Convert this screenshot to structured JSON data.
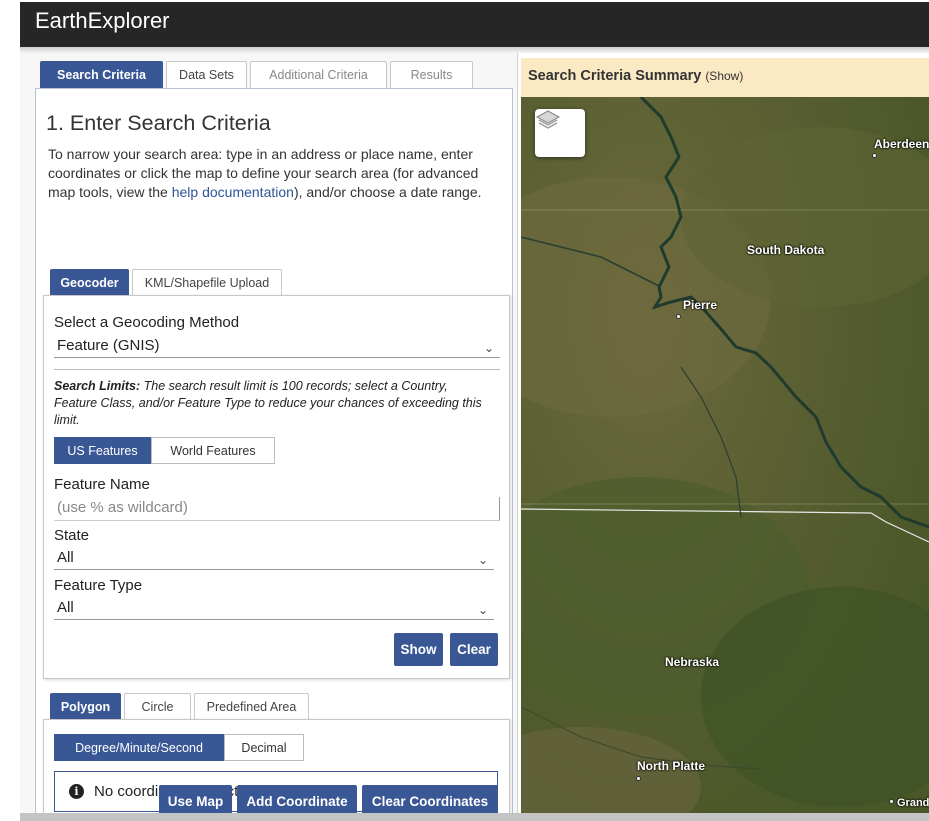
{
  "app": {
    "title": "EarthExplorer"
  },
  "main_tabs": [
    {
      "label": "Search Criteria"
    },
    {
      "label": "Data Sets"
    },
    {
      "label": "Additional Criteria"
    },
    {
      "label": "Results"
    }
  ],
  "search": {
    "heading": "1. Enter Search Criteria",
    "intro_before": "To narrow your search area: type in an address or place name, enter coordinates or click the map to define your search area (for advanced map tools, view the ",
    "intro_link": "help documentation",
    "intro_after": "), and/or choose a date range."
  },
  "geo_tabs": [
    {
      "label": "Geocoder"
    },
    {
      "label": "KML/Shapefile Upload"
    }
  ],
  "geocoder": {
    "method_label": "Select a Geocoding Method",
    "method_value": "Feature (GNIS)",
    "limits_bold": "Search Limits:",
    "limits_text": " The search result limit is 100 records; select a Country, Feature Class, and/or Feature Type to reduce your chances of exceeding this limit.",
    "feature_tabs": [
      {
        "label": "US Features"
      },
      {
        "label": "World Features"
      }
    ],
    "feature_name_label": "Feature Name",
    "feature_name_placeholder": "(use % as wildcard)",
    "state_label": "State",
    "state_value": "All",
    "feature_type_label": "Feature Type",
    "feature_type_value": "All",
    "show_label": "Show",
    "clear_label": "Clear"
  },
  "area_tabs": [
    {
      "label": "Polygon"
    },
    {
      "label": "Circle"
    },
    {
      "label": "Predefined Area"
    }
  ],
  "coords": {
    "format_tabs": [
      {
        "label": "Degree/Minute/Second"
      },
      {
        "label": "Decimal"
      }
    ],
    "notice": "No coordinates selected.",
    "use_map_label": "Use Map",
    "add_coordinate_label": "Add Coordinate",
    "clear_coordinates_label": "Clear Coordinates"
  },
  "summary": {
    "title": "Search Criteria Summary",
    "toggle": "(Show)"
  },
  "map": {
    "labels": {
      "aberdeen": "Aberdeen",
      "south_dakota": "South Dakota",
      "pierre": "Pierre",
      "nebraska": "Nebraska",
      "north_platte": "North Platte",
      "grand": "Grand"
    },
    "icons": {
      "layers": "layers-icon",
      "info": "info-icon",
      "chevron": "chevron-down-icon"
    },
    "colors": {
      "accent": "#3a5795",
      "summary_bg": "#fbe9c4",
      "topbar": "#262626"
    }
  }
}
